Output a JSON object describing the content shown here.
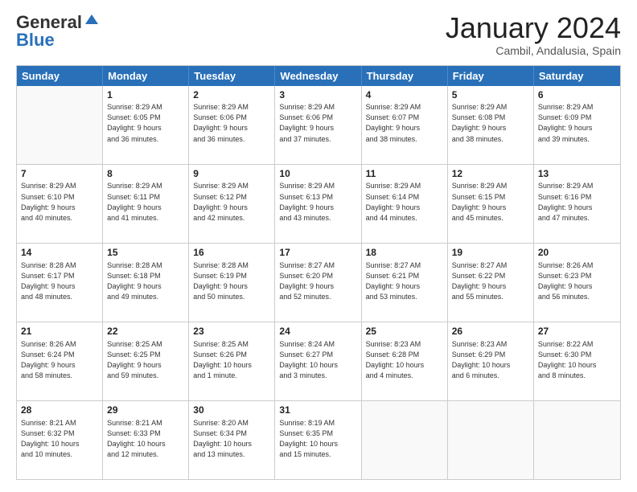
{
  "header": {
    "logo_general": "General",
    "logo_blue": "Blue",
    "month_year": "January 2024",
    "location": "Cambil, Andalusia, Spain"
  },
  "weekdays": [
    "Sunday",
    "Monday",
    "Tuesday",
    "Wednesday",
    "Thursday",
    "Friday",
    "Saturday"
  ],
  "weeks": [
    [
      {
        "day": "",
        "info": ""
      },
      {
        "day": "1",
        "info": "Sunrise: 8:29 AM\nSunset: 6:05 PM\nDaylight: 9 hours\nand 36 minutes."
      },
      {
        "day": "2",
        "info": "Sunrise: 8:29 AM\nSunset: 6:06 PM\nDaylight: 9 hours\nand 36 minutes."
      },
      {
        "day": "3",
        "info": "Sunrise: 8:29 AM\nSunset: 6:06 PM\nDaylight: 9 hours\nand 37 minutes."
      },
      {
        "day": "4",
        "info": "Sunrise: 8:29 AM\nSunset: 6:07 PM\nDaylight: 9 hours\nand 38 minutes."
      },
      {
        "day": "5",
        "info": "Sunrise: 8:29 AM\nSunset: 6:08 PM\nDaylight: 9 hours\nand 38 minutes."
      },
      {
        "day": "6",
        "info": "Sunrise: 8:29 AM\nSunset: 6:09 PM\nDaylight: 9 hours\nand 39 minutes."
      }
    ],
    [
      {
        "day": "7",
        "info": "Sunrise: 8:29 AM\nSunset: 6:10 PM\nDaylight: 9 hours\nand 40 minutes."
      },
      {
        "day": "8",
        "info": "Sunrise: 8:29 AM\nSunset: 6:11 PM\nDaylight: 9 hours\nand 41 minutes."
      },
      {
        "day": "9",
        "info": "Sunrise: 8:29 AM\nSunset: 6:12 PM\nDaylight: 9 hours\nand 42 minutes."
      },
      {
        "day": "10",
        "info": "Sunrise: 8:29 AM\nSunset: 6:13 PM\nDaylight: 9 hours\nand 43 minutes."
      },
      {
        "day": "11",
        "info": "Sunrise: 8:29 AM\nSunset: 6:14 PM\nDaylight: 9 hours\nand 44 minutes."
      },
      {
        "day": "12",
        "info": "Sunrise: 8:29 AM\nSunset: 6:15 PM\nDaylight: 9 hours\nand 45 minutes."
      },
      {
        "day": "13",
        "info": "Sunrise: 8:29 AM\nSunset: 6:16 PM\nDaylight: 9 hours\nand 47 minutes."
      }
    ],
    [
      {
        "day": "14",
        "info": "Sunrise: 8:28 AM\nSunset: 6:17 PM\nDaylight: 9 hours\nand 48 minutes."
      },
      {
        "day": "15",
        "info": "Sunrise: 8:28 AM\nSunset: 6:18 PM\nDaylight: 9 hours\nand 49 minutes."
      },
      {
        "day": "16",
        "info": "Sunrise: 8:28 AM\nSunset: 6:19 PM\nDaylight: 9 hours\nand 50 minutes."
      },
      {
        "day": "17",
        "info": "Sunrise: 8:27 AM\nSunset: 6:20 PM\nDaylight: 9 hours\nand 52 minutes."
      },
      {
        "day": "18",
        "info": "Sunrise: 8:27 AM\nSunset: 6:21 PM\nDaylight: 9 hours\nand 53 minutes."
      },
      {
        "day": "19",
        "info": "Sunrise: 8:27 AM\nSunset: 6:22 PM\nDaylight: 9 hours\nand 55 minutes."
      },
      {
        "day": "20",
        "info": "Sunrise: 8:26 AM\nSunset: 6:23 PM\nDaylight: 9 hours\nand 56 minutes."
      }
    ],
    [
      {
        "day": "21",
        "info": "Sunrise: 8:26 AM\nSunset: 6:24 PM\nDaylight: 9 hours\nand 58 minutes."
      },
      {
        "day": "22",
        "info": "Sunrise: 8:25 AM\nSunset: 6:25 PM\nDaylight: 9 hours\nand 59 minutes."
      },
      {
        "day": "23",
        "info": "Sunrise: 8:25 AM\nSunset: 6:26 PM\nDaylight: 10 hours\nand 1 minute."
      },
      {
        "day": "24",
        "info": "Sunrise: 8:24 AM\nSunset: 6:27 PM\nDaylight: 10 hours\nand 3 minutes."
      },
      {
        "day": "25",
        "info": "Sunrise: 8:23 AM\nSunset: 6:28 PM\nDaylight: 10 hours\nand 4 minutes."
      },
      {
        "day": "26",
        "info": "Sunrise: 8:23 AM\nSunset: 6:29 PM\nDaylight: 10 hours\nand 6 minutes."
      },
      {
        "day": "27",
        "info": "Sunrise: 8:22 AM\nSunset: 6:30 PM\nDaylight: 10 hours\nand 8 minutes."
      }
    ],
    [
      {
        "day": "28",
        "info": "Sunrise: 8:21 AM\nSunset: 6:32 PM\nDaylight: 10 hours\nand 10 minutes."
      },
      {
        "day": "29",
        "info": "Sunrise: 8:21 AM\nSunset: 6:33 PM\nDaylight: 10 hours\nand 12 minutes."
      },
      {
        "day": "30",
        "info": "Sunrise: 8:20 AM\nSunset: 6:34 PM\nDaylight: 10 hours\nand 13 minutes."
      },
      {
        "day": "31",
        "info": "Sunrise: 8:19 AM\nSunset: 6:35 PM\nDaylight: 10 hours\nand 15 minutes."
      },
      {
        "day": "",
        "info": ""
      },
      {
        "day": "",
        "info": ""
      },
      {
        "day": "",
        "info": ""
      }
    ]
  ]
}
